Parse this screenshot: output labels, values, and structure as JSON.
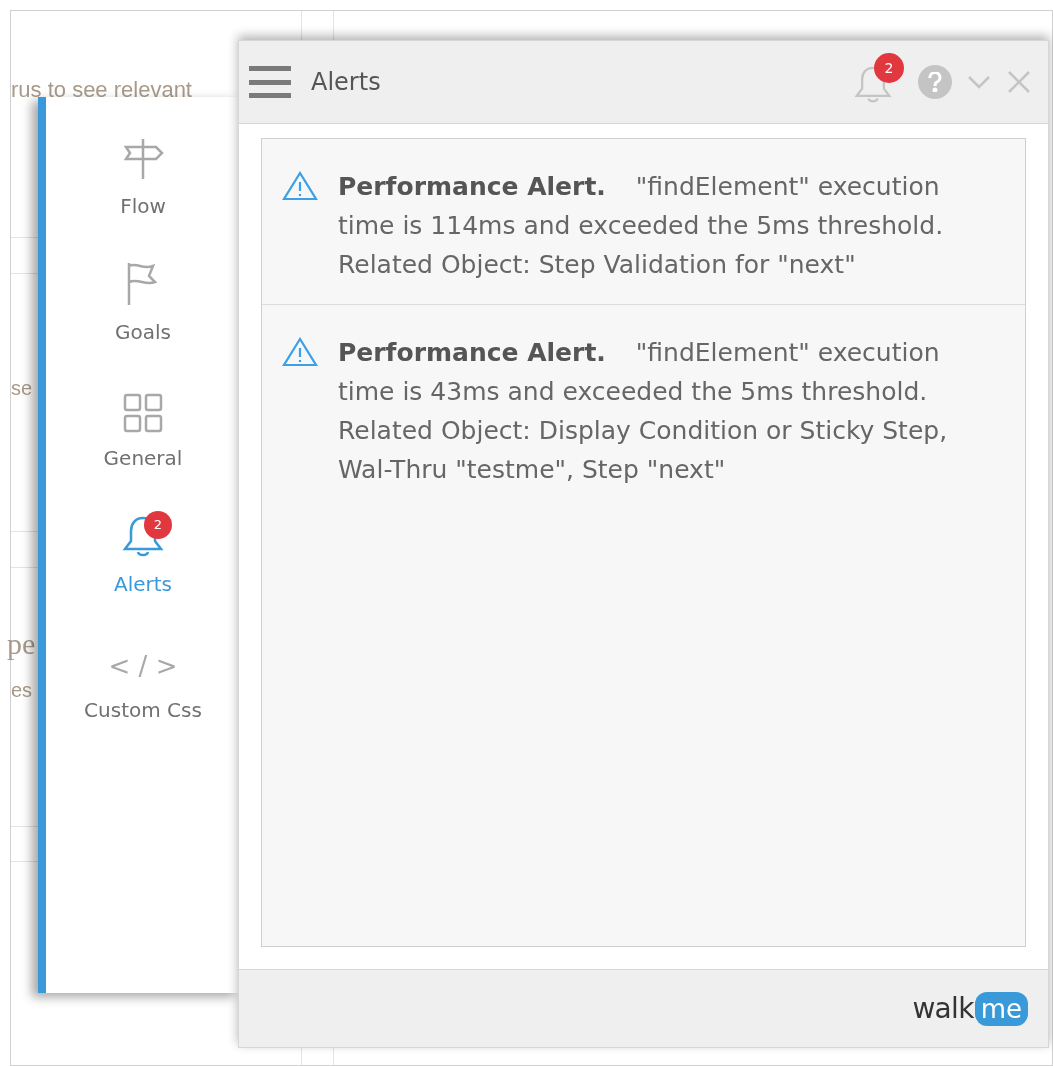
{
  "background_page": {
    "fragments": [
      "rus to see relevant",
      "se",
      "pe",
      "es"
    ]
  },
  "sidebar": {
    "items": [
      {
        "label": "Flow",
        "selected": false
      },
      {
        "label": "Goals",
        "selected": false
      },
      {
        "label": "General",
        "selected": false
      },
      {
        "label": "Alerts",
        "selected": true,
        "badge": "2"
      },
      {
        "label": "Custom Css",
        "selected": false,
        "glyph": "< / >"
      }
    ]
  },
  "window": {
    "title": "Alerts",
    "notification_badge": "2"
  },
  "alerts": [
    {
      "title": "Performance Alert.",
      "message": "\"findElement\" execution time is 114ms and exceeded the 5ms threshold. Related Object: Step Validation for \"next\""
    },
    {
      "title": "Performance Alert.",
      "message": "\"findElement\" execution time is 43ms and exceeded the 5ms threshold. Related Object: Display Condition or Sticky Step, Wal-Thru \"testme\", Step \"next\""
    }
  ],
  "footer": {
    "logo": {
      "word": "walk",
      "bubble": "me"
    }
  }
}
